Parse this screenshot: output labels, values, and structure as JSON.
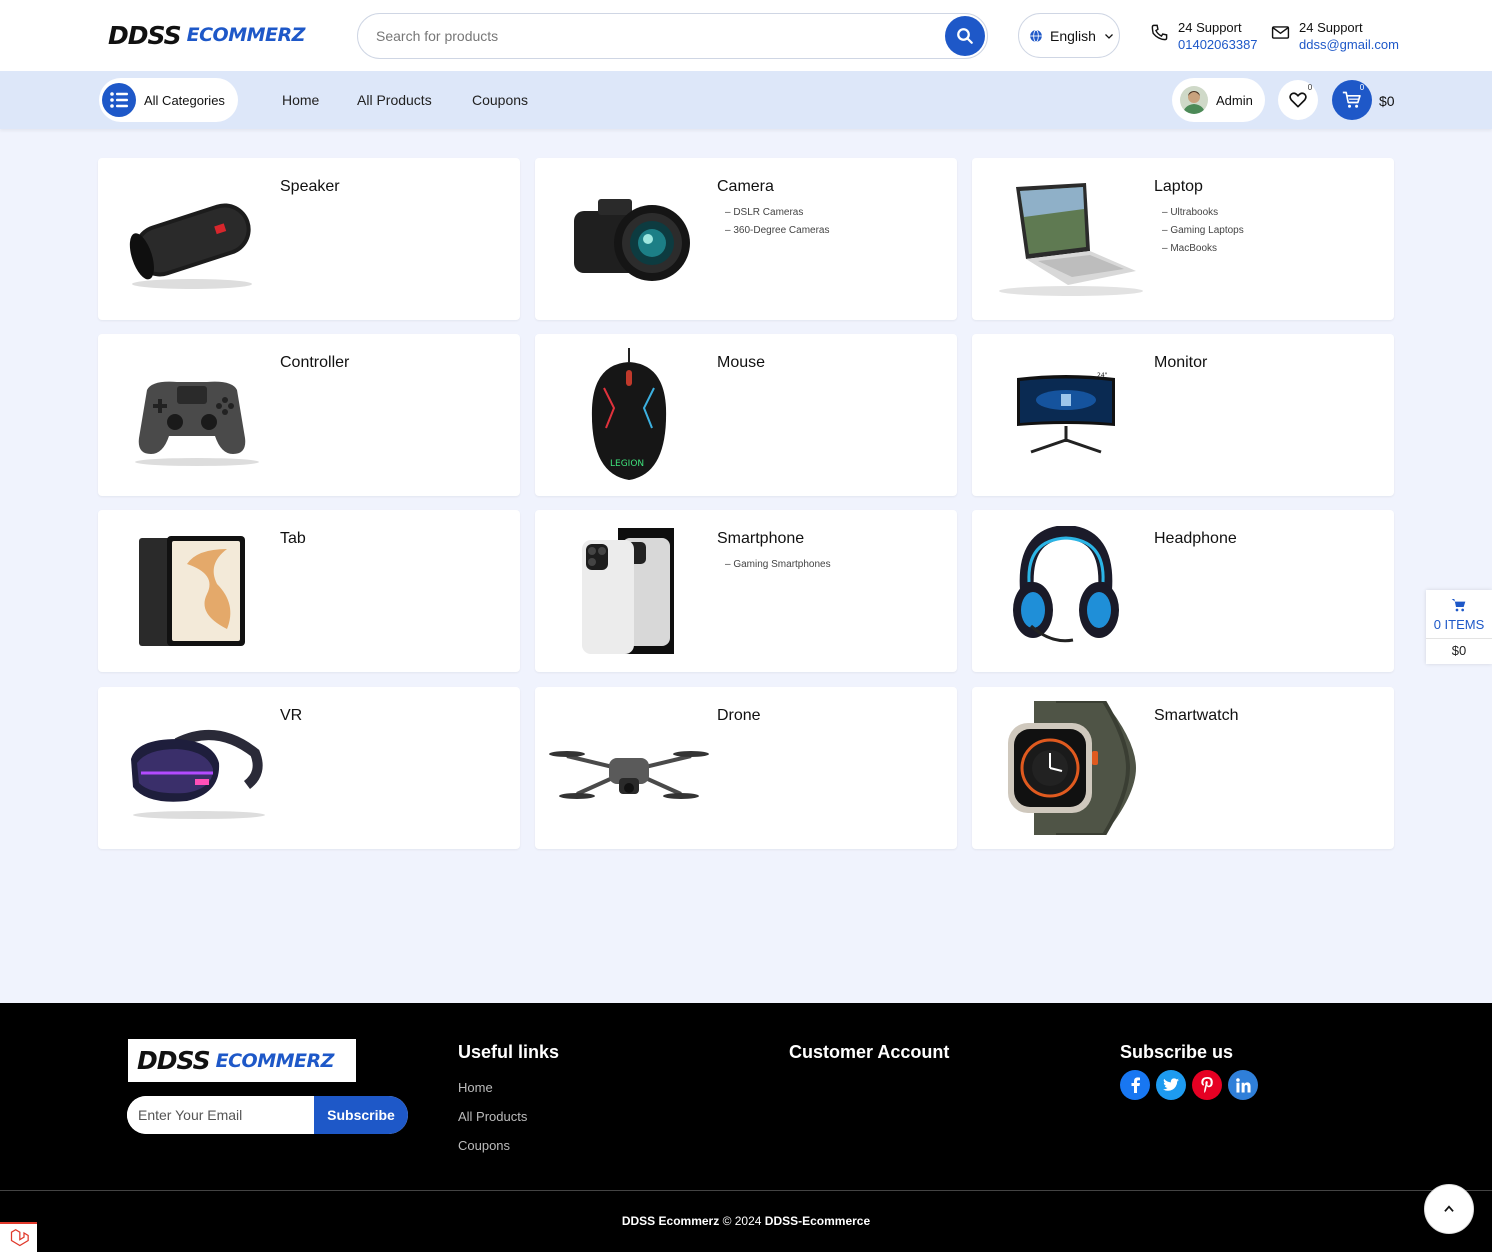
{
  "header": {
    "logo_part1": "DDSS",
    "logo_part2": "ECOMMERZ",
    "search_placeholder": "Search for products",
    "language": "English",
    "support_phone_label": "24 Support",
    "support_phone": "01402063387",
    "support_email_label": "24 Support",
    "support_email": "ddss@gmail.com"
  },
  "nav": {
    "all_categories": "All Categories",
    "menu": [
      "Home",
      "All Products",
      "Coupons"
    ],
    "user": "Admin",
    "wishlist_count": "0",
    "cart_count": "0",
    "cart_total": "$0"
  },
  "categories": [
    {
      "name": "Speaker",
      "subs": [],
      "icon": "speaker-image"
    },
    {
      "name": "Camera",
      "subs": [
        "– DSLR Cameras",
        "– 360-Degree Cameras"
      ],
      "icon": "camera-image"
    },
    {
      "name": "Laptop",
      "subs": [
        "– Ultrabooks",
        "– Gaming Laptops",
        "– MacBooks"
      ],
      "icon": "laptop-image"
    },
    {
      "name": "Controller",
      "subs": [],
      "icon": "controller-image"
    },
    {
      "name": "Mouse",
      "subs": [],
      "icon": "mouse-image"
    },
    {
      "name": "Monitor",
      "subs": [],
      "icon": "monitor-image"
    },
    {
      "name": "Tab",
      "subs": [],
      "icon": "tablet-image"
    },
    {
      "name": "Smartphone",
      "subs": [
        "– Gaming Smartphones"
      ],
      "icon": "smartphone-image"
    },
    {
      "name": "Headphone",
      "subs": [],
      "icon": "headphone-image"
    },
    {
      "name": "VR",
      "subs": [],
      "icon": "vr-headset-image"
    },
    {
      "name": "Drone",
      "subs": [],
      "icon": "drone-image"
    },
    {
      "name": "Smartwatch",
      "subs": [],
      "icon": "smartwatch-image"
    }
  ],
  "floating_cart": {
    "items": "0 ITEMS",
    "total": "$0"
  },
  "footer": {
    "logo_part1": "DDSS",
    "logo_part2": "ECOMMERZ",
    "email_placeholder": "Enter Your Email",
    "subscribe_button": "Subscribe",
    "useful_links_title": "Useful links",
    "useful_links": [
      "Home",
      "All Products",
      "Coupons"
    ],
    "customer_account_title": "Customer Account",
    "subscribe_title": "Subscribe us",
    "social": [
      {
        "name": "facebook-icon",
        "color": "#1877f2"
      },
      {
        "name": "twitter-icon",
        "color": "#1d9bf0"
      },
      {
        "name": "pinterest-icon",
        "color": "#e60023"
      },
      {
        "name": "linkedin-icon",
        "color": "#2f7fd9"
      }
    ],
    "copyright_brand": "DDSS Ecommerz",
    "copyright_text": "© 2024",
    "copyright_owner": "DDSS-Ecommerce"
  },
  "colors": {
    "accent": "#1e58c8",
    "nav_bg": "#dde7f9",
    "page_bg": "#f0f3fd"
  }
}
